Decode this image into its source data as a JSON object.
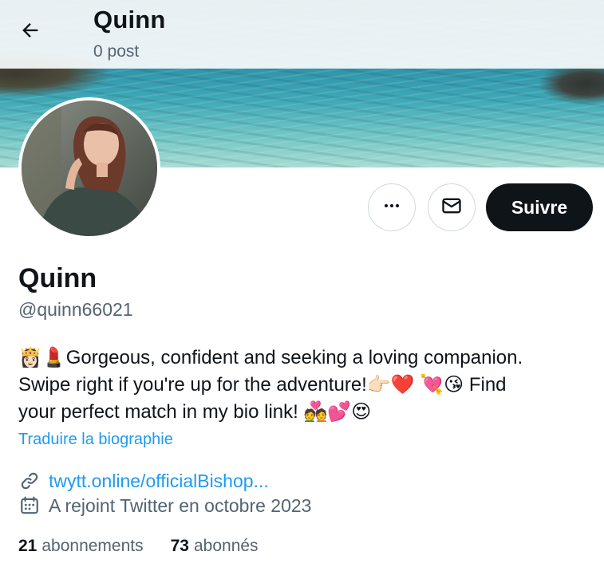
{
  "header": {
    "name": "Quinn",
    "posts": "0 post"
  },
  "profile": {
    "display_name": "Quinn",
    "handle": "@quinn66021",
    "bio": "👸🏻💄Gorgeous, confident and seeking a loving companion.\nSwipe right if you're up for the adventure!👉🏻❤️ 💘😘 Find\nyour perfect match in my bio link! 💑💕😍",
    "translate_label": "Traduire la biographie",
    "link": "twytt.online/officialBishop...",
    "joined": "A rejoint Twitter en octobre 2023",
    "following_count": "21",
    "following_label": "abonnements",
    "followers_count": "73",
    "followers_label": "abonnés"
  },
  "actions": {
    "follow_label": "Suivre",
    "more_icon": "more-dots-icon",
    "message_icon": "envelope-icon"
  },
  "colors": {
    "text": "#0f1419",
    "secondary": "#536471",
    "link": "#1d9bf0",
    "follow_bg": "#0f1419",
    "border": "#cfd9de"
  }
}
